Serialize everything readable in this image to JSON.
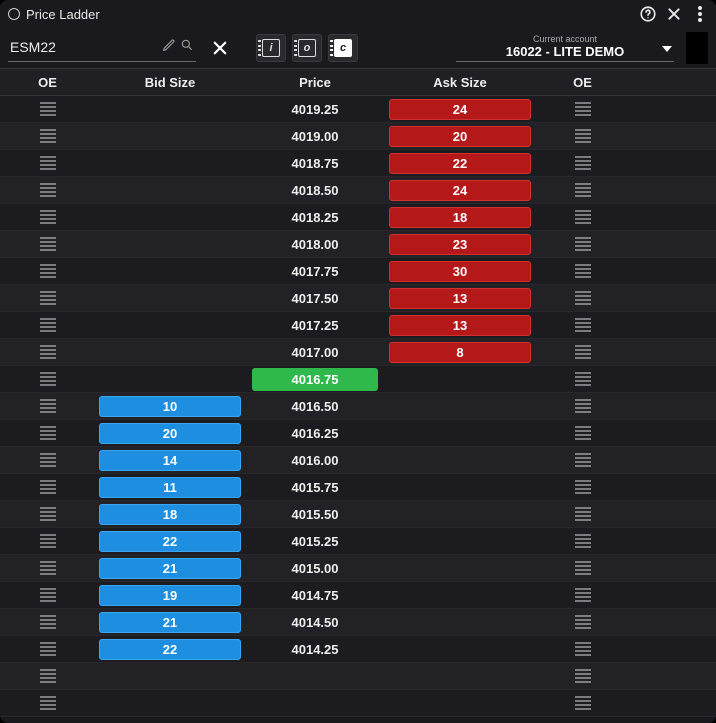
{
  "title": "Price Ladder",
  "toolbar": {
    "symbol": "ESM22",
    "modes": [
      "i",
      "o",
      "c"
    ],
    "account_label": "Current account",
    "account_value": "16022 - LITE DEMO"
  },
  "headers": {
    "oe": "OE",
    "bid": "Bid Size",
    "price": "Price",
    "ask": "Ask Size"
  },
  "colors": {
    "bid": "#1e8fe0",
    "ask": "#b41818",
    "last": "#2fb84c"
  },
  "rows": [
    {
      "price": "4019.25",
      "bid": null,
      "ask": "24",
      "last": false
    },
    {
      "price": "4019.00",
      "bid": null,
      "ask": "20",
      "last": false
    },
    {
      "price": "4018.75",
      "bid": null,
      "ask": "22",
      "last": false
    },
    {
      "price": "4018.50",
      "bid": null,
      "ask": "24",
      "last": false
    },
    {
      "price": "4018.25",
      "bid": null,
      "ask": "18",
      "last": false
    },
    {
      "price": "4018.00",
      "bid": null,
      "ask": "23",
      "last": false
    },
    {
      "price": "4017.75",
      "bid": null,
      "ask": "30",
      "last": false
    },
    {
      "price": "4017.50",
      "bid": null,
      "ask": "13",
      "last": false
    },
    {
      "price": "4017.25",
      "bid": null,
      "ask": "13",
      "last": false
    },
    {
      "price": "4017.00",
      "bid": null,
      "ask": "8",
      "last": false
    },
    {
      "price": "4016.75",
      "bid": null,
      "ask": null,
      "last": true
    },
    {
      "price": "4016.50",
      "bid": "10",
      "ask": null,
      "last": false
    },
    {
      "price": "4016.25",
      "bid": "20",
      "ask": null,
      "last": false
    },
    {
      "price": "4016.00",
      "bid": "14",
      "ask": null,
      "last": false
    },
    {
      "price": "4015.75",
      "bid": "11",
      "ask": null,
      "last": false
    },
    {
      "price": "4015.50",
      "bid": "18",
      "ask": null,
      "last": false
    },
    {
      "price": "4015.25",
      "bid": "22",
      "ask": null,
      "last": false
    },
    {
      "price": "4015.00",
      "bid": "21",
      "ask": null,
      "last": false
    },
    {
      "price": "4014.75",
      "bid": "19",
      "ask": null,
      "last": false
    },
    {
      "price": "4014.50",
      "bid": "21",
      "ask": null,
      "last": false
    },
    {
      "price": "4014.25",
      "bid": "22",
      "ask": null,
      "last": false
    },
    {
      "price": "",
      "bid": null,
      "ask": null,
      "last": false
    },
    {
      "price": "",
      "bid": null,
      "ask": null,
      "last": false
    }
  ]
}
